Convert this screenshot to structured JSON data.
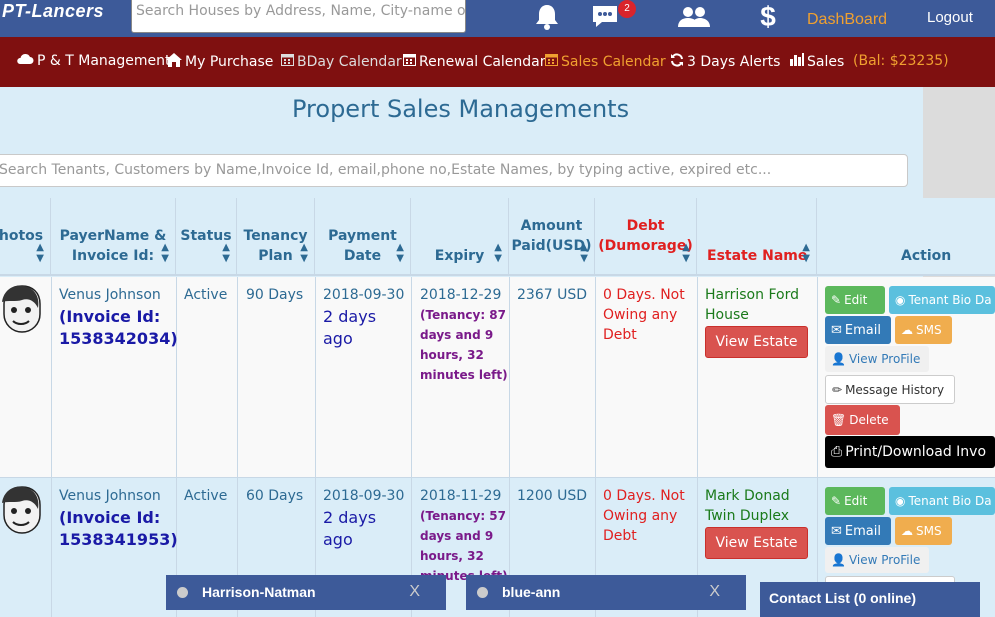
{
  "brand": "PT-Lancers",
  "top_search": {
    "placeholder": "Search Houses by Address, Name, City-name or S"
  },
  "top_nav": {
    "messages_badge": "2",
    "dashboard": "DashBoard",
    "logout": "Logout"
  },
  "sub_nav": {
    "items": [
      {
        "label": "P & T Management",
        "icon": "cloud-icon"
      },
      {
        "label": "My Purchase",
        "icon": "home-icon"
      },
      {
        "label": "BDay Calendar",
        "icon": "calendar-icon"
      },
      {
        "label": "Renewal Calendar",
        "icon": "calendar-icon"
      },
      {
        "label": "Sales Calendar",
        "icon": "calendar-icon"
      },
      {
        "label": "3 Days Alerts",
        "icon": "refresh-icon"
      },
      {
        "label": "Sales",
        "icon": "bar-chart-icon"
      }
    ],
    "balance": "(Bal: $23235)"
  },
  "page_title": "Propert Sales Managements",
  "table_search": {
    "placeholder": "Search Tenants, Customers by Name,Invoice Id, email,phone no,Estate Names, by typing active, expired etc..."
  },
  "columns": {
    "photos": "hotos",
    "payer": [
      "PayerName &",
      "Invoice Id:"
    ],
    "status": "Status",
    "plan": [
      "Tenancy",
      "Plan"
    ],
    "paydate": [
      "Payment",
      "Date"
    ],
    "expiry": "Expiry",
    "amount": [
      "Amount",
      "Paid(USD)"
    ],
    "debt": [
      "Debt",
      "(Dumorage)"
    ],
    "estate": "Estate Name",
    "action": "Action"
  },
  "rows": [
    {
      "payer": "Venus Johnson",
      "invoice": [
        "(Invoice Id:",
        "1538342034)"
      ],
      "status": "Active",
      "plan": "90 Days",
      "pay_date": "2018-09-30",
      "pay_ago": [
        "2 days",
        "ago"
      ],
      "expiry": "2018-12-29",
      "tenancy_left": [
        "(Tenancy: 87",
        "days and 9",
        "hours, 32",
        "minutes left)"
      ],
      "amount": "2367 USD",
      "debt": [
        "0 Days. Not",
        "Owing any",
        "Debt"
      ],
      "estate": [
        "Harrison Ford",
        "House"
      ]
    },
    {
      "payer": "Venus Johnson",
      "invoice": [
        "(Invoice Id:",
        "1538341953)"
      ],
      "status": "Active",
      "plan": "60 Days",
      "pay_date": "2018-09-30",
      "pay_ago": [
        "2 days",
        "ago"
      ],
      "expiry": "2018-11-29",
      "tenancy_left": [
        "(Tenancy: 57",
        "days and 9",
        "hours, 32",
        "minutes left)"
      ],
      "amount": "1200 USD",
      "debt": [
        "0 Days. Not",
        "Owing any",
        "Debt"
      ],
      "estate": [
        "Mark Donad",
        "Twin Duplex"
      ]
    }
  ],
  "actions": {
    "view_estate": "View Estate",
    "edit": "Edit",
    "tenant_bio": "Tenant Bio Da",
    "email": "Email",
    "sms": "SMS",
    "view_profile": "View ProFile",
    "message_history": "Message History",
    "delete": "Delete",
    "print": "Print/Download Invo"
  },
  "chat": {
    "bars": [
      {
        "name": "Harrison-Natman",
        "close": "X"
      },
      {
        "name": "blue-ann",
        "close": "X"
      }
    ],
    "contact_list": "Contact List (0 online)"
  },
  "colors": {
    "navbar": "#3d5a99",
    "subnav": "#7f1010",
    "accent_orange": "#f0a030",
    "title_blue": "#2d6a93"
  }
}
